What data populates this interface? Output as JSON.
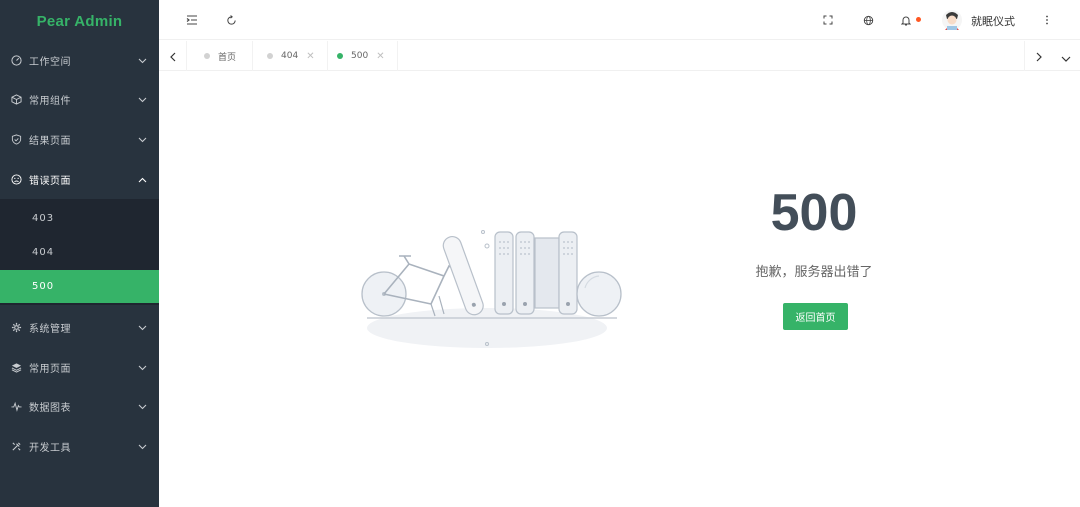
{
  "app": {
    "title": "Pear Admin"
  },
  "sidebar": {
    "menus": [
      {
        "label": "工作空间",
        "icon": "gauge-icon"
      },
      {
        "label": "常用组件",
        "icon": "cube-icon"
      },
      {
        "label": "结果页面",
        "icon": "shield-check-icon"
      },
      {
        "label": "错误页面",
        "icon": "sad-face-icon",
        "expanded": true
      },
      {
        "label": "系统管理",
        "icon": "gear-icon"
      },
      {
        "label": "常用页面",
        "icon": "layers-icon"
      },
      {
        "label": "数据图表",
        "icon": "pulse-icon"
      },
      {
        "label": "开发工具",
        "icon": "tools-icon"
      }
    ],
    "error_submenu": [
      {
        "label": "403"
      },
      {
        "label": "404"
      },
      {
        "label": "500",
        "active": true
      }
    ]
  },
  "header": {
    "username": "就眠仪式",
    "icons": [
      "menu-fold-icon",
      "refresh-icon",
      "fullscreen-icon",
      "globe-icon",
      "bell-icon",
      "more-vertical-icon"
    ],
    "notification_dot_color": "#ff5722"
  },
  "tabs": [
    {
      "label": "首页",
      "closable": false,
      "active": false
    },
    {
      "label": "404",
      "closable": true,
      "active": false
    },
    {
      "label": "500",
      "closable": true,
      "active": true
    }
  ],
  "error": {
    "code": "500",
    "message": "抱歉，服务器出错了",
    "button_label": "返回首页"
  },
  "colors": {
    "accent": "#36b368",
    "sidebar": "#28333e",
    "submenu": "#1f2630",
    "code": "#434e59"
  }
}
